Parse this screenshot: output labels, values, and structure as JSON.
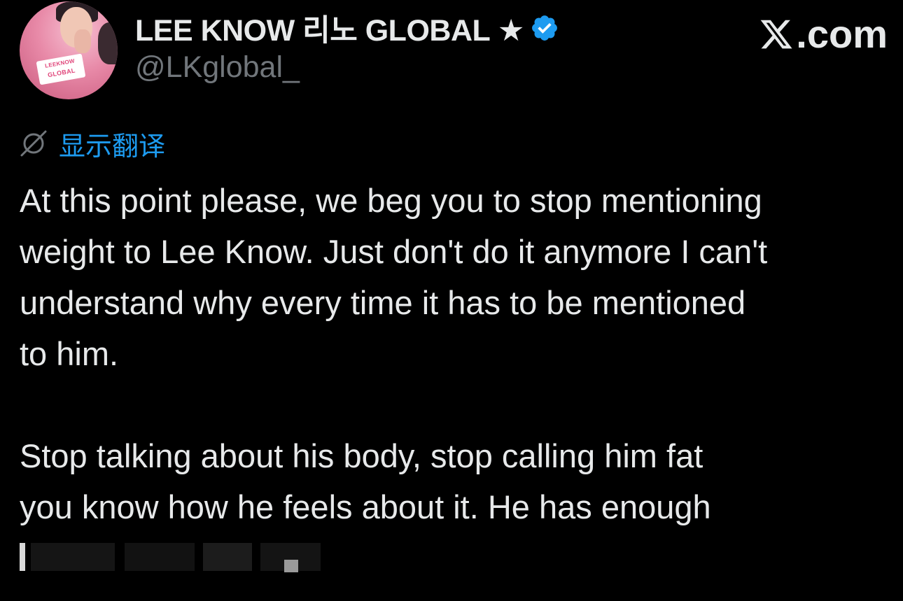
{
  "account": {
    "display_name": "LEE KNOW 리노 GLOBAL ★",
    "handle": "@LKglobal_",
    "verified": true,
    "avatar_logo_top": "LEEKNOW",
    "avatar_logo_bottom": "GLOBAL"
  },
  "brand": {
    "label": ".com",
    "icon": "x-logo-icon"
  },
  "translate": {
    "label": "显示翻译",
    "icon": "globe-translate-icon"
  },
  "tweet": {
    "paragraph_1": "At this point please, we beg you to stop mentioning\nweight to Lee Know. Just don't do it anymore I can't\nunderstand why every time it has to be mentioned\nto him.",
    "paragraph_2": "Stop talking about his body, stop calling him fat\nyou know how he feels about it. He has enough"
  },
  "colors": {
    "background": "#000000",
    "text_primary": "#e7e9ea",
    "text_secondary": "#71767b",
    "accent_blue": "#1d9bf0"
  }
}
